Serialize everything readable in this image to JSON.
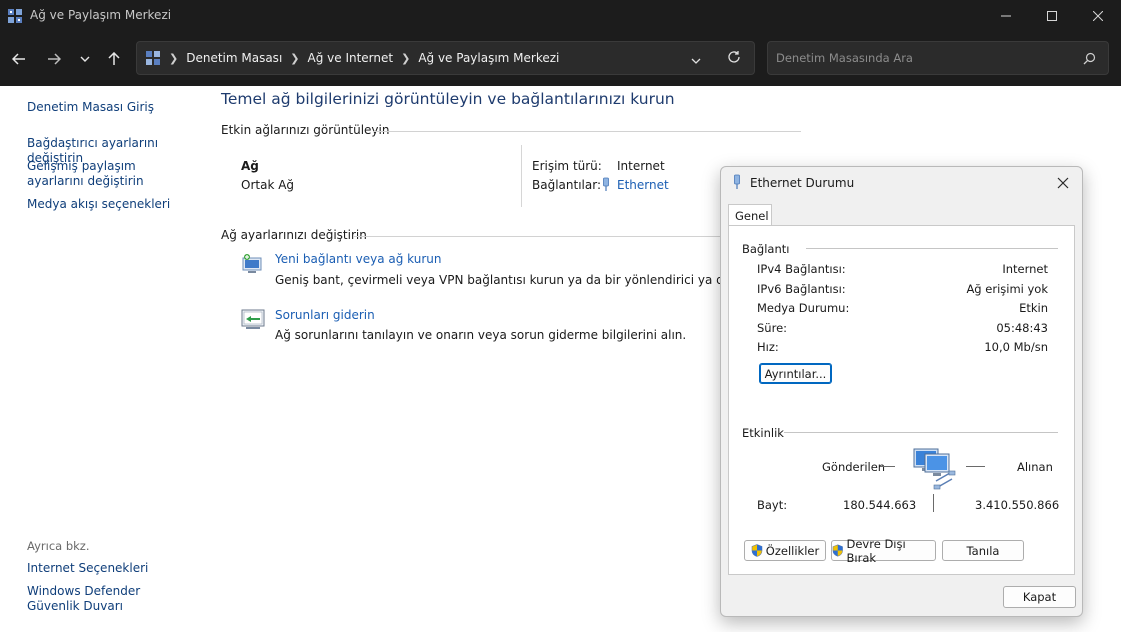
{
  "window": {
    "title": "Ağ ve Paylaşım Merkezi"
  },
  "nav": {
    "breadcrumbs": [
      "Denetim Masası",
      "Ağ ve Internet",
      "Ağ ve Paylaşım Merkezi"
    ],
    "search_placeholder": "Denetim Masasında Ara"
  },
  "sidebar": {
    "items": [
      {
        "label": "Denetim Masası Giriş"
      },
      {
        "label": "Bağdaştırıcı ayarlarını değiştirin"
      },
      {
        "label": "Gelişmiş paylaşım ayarlarını değiştirin"
      },
      {
        "label": "Medya akışı seçenekleri"
      }
    ],
    "see_also_label": "Ayrıca bkz.",
    "see_also": [
      {
        "label": "Internet Seçenekleri"
      },
      {
        "label": "Windows Defender Güvenlik Duvarı"
      }
    ]
  },
  "main": {
    "title": "Temel ağ bilgilerinizi görüntüleyin ve bağlantılarınızı kurun",
    "active_networks_heading": "Etkin ağlarınızı görüntüleyin",
    "network": {
      "name": "Ağ",
      "type": "Ortak Ağ",
      "access_label": "Erişim türü:",
      "access_value": "Internet",
      "connections_label": "Bağlantılar:",
      "connections_value": "Ethernet"
    },
    "change_heading": "Ağ ayarlarınızı değiştirin",
    "tasks": [
      {
        "title": "Yeni bağlantı veya ağ kurun",
        "desc": "Geniş bant, çevirmeli veya VPN bağlantısı kurun ya da bir yönlendirici ya da erişim no"
      },
      {
        "title": "Sorunları giderin",
        "desc": "Ağ sorunlarını tanılayın ve onarın veya sorun giderme bilgilerini alın."
      }
    ]
  },
  "dialog": {
    "title": "Ethernet Durumu",
    "tab": "Genel",
    "connection_group": "Bağlantı",
    "rows": [
      {
        "label": "IPv4 Bağlantısı:",
        "value": "Internet"
      },
      {
        "label": "IPv6 Bağlantısı:",
        "value": "Ağ erişimi yok"
      },
      {
        "label": "Medya Durumu:",
        "value": "Etkin"
      },
      {
        "label": "Süre:",
        "value": "05:48:43"
      },
      {
        "label": "Hız:",
        "value": "10,0 Mb/sn"
      }
    ],
    "details_button": "Ayrıntılar...",
    "activity_group": "Etkinlik",
    "sent_label": "Gönderilen",
    "received_label": "Alınan",
    "bytes_label": "Bayt:",
    "bytes_sent": "180.544.663",
    "bytes_received": "3.410.550.866",
    "properties_button": "Özellikler",
    "disable_button": "Devre Dışı Bırak",
    "diagnose_button": "Tanıla",
    "close_button": "Kapat"
  }
}
